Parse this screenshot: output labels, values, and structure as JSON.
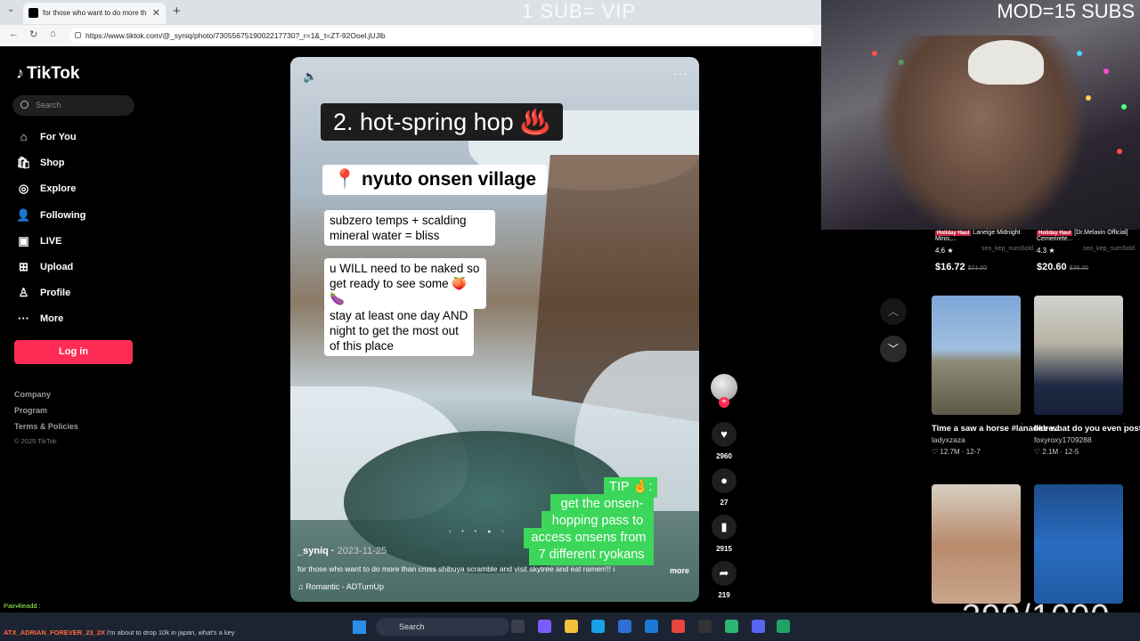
{
  "browser": {
    "tab_title": "for those who want to do more th",
    "url": "https://www.tiktok.com/@_syniq/photo/7305567519002217730?_r=1&_t=ZT-92Ooel.jUJlb"
  },
  "stream_overlay": {
    "sub_text": "1 SUB= VIP",
    "mod_text": "MOD=15 SUBS",
    "counter": "399/1000"
  },
  "sidebar": {
    "logo": "TikTok",
    "search_placeholder": "Search",
    "items": [
      {
        "label": "For You",
        "icon": "home-icon"
      },
      {
        "label": "Shop",
        "icon": "shop-icon"
      },
      {
        "label": "Explore",
        "icon": "compass-icon"
      },
      {
        "label": "Following",
        "icon": "following-icon"
      },
      {
        "label": "LIVE",
        "icon": "live-icon"
      },
      {
        "label": "Upload",
        "icon": "upload-icon"
      },
      {
        "label": "Profile",
        "icon": "profile-icon"
      },
      {
        "label": "More",
        "icon": "more-dots-icon"
      }
    ],
    "login_label": "Log in",
    "footer": [
      "Company",
      "Program",
      "Terms & Policies"
    ],
    "copyright": "© 2025 TikTok"
  },
  "post": {
    "caption_title": "2. hot-spring hop ♨️",
    "caption_location": "📍 nyuto onsen village",
    "caption_lines": [
      "subzero temps + scalding\nmineral water = bliss",
      "u WILL need to be naked so\nget ready to see some 🍑🍆",
      "stay at least one day AND\nnight to get the most out\nof this place"
    ],
    "tip_lines": [
      "TIP 🤞:",
      "get the onsen-",
      "hopping pass to",
      "access onsens from",
      "7 different ryokans"
    ],
    "author": "_syniq",
    "date": "2023-11-25",
    "description": "for those who want to do more than cross shibuya scramble and visit skytree and eat ramen!!! i",
    "more_label": "more",
    "music": "Romantic - ADTurnUp",
    "likes": "2960",
    "comments": "27",
    "saves": "2915",
    "shares": "219"
  },
  "products": [
    {
      "badge": "Holiday Haul",
      "title": "Laneige Midnight Minis,...",
      "rating": "4.6 ★",
      "sold": "seo_kep_numSold",
      "price": "$16.72",
      "old_price": "$21.00"
    },
    {
      "badge": "Holiday Haul",
      "title": "[Dr.Melaxin Official] Cemenrete...",
      "rating": "4.3 ★",
      "sold": "seo_kep_numSold",
      "price": "$20.60",
      "old_price": "$36.00"
    }
  ],
  "related": [
    {
      "title": "Time a saw a horse #lanadelre...",
      "user": "ladyxzaza",
      "plays": "12.7M",
      "date": "12-7"
    },
    {
      "title": "like what do you even post after...",
      "user": "foxyroxy1709288",
      "plays": "2.1M",
      "date": "12-5"
    }
  ],
  "chat": {
    "line1": "Pain4leadd :",
    "line2_user": "ATX_ADRIAN_FOREVER_23_2X",
    "line2_text": "i'm about to drop 10k in japan, what's a key"
  },
  "taskbar": {
    "search_label": "Search"
  },
  "colors": {
    "accent": "#fe2c55",
    "tip_green": "#3cd65a"
  }
}
